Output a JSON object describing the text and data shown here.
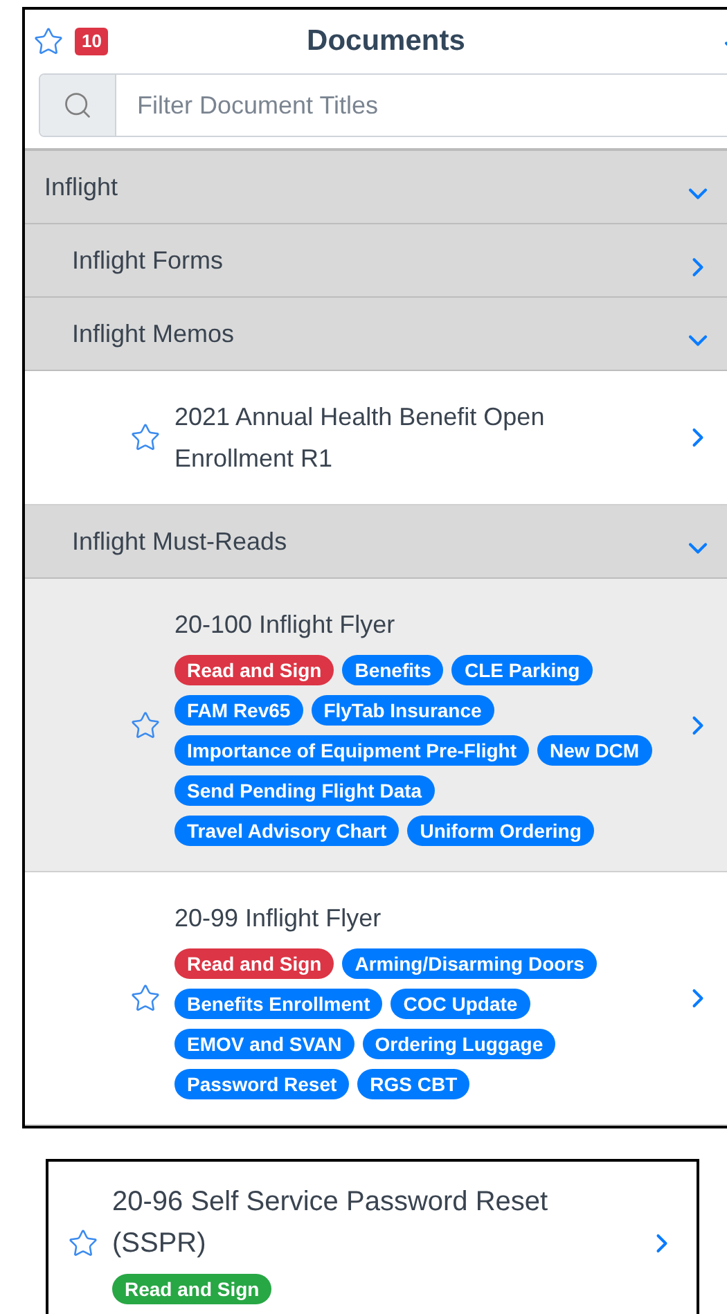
{
  "header": {
    "favorite": false,
    "badge": "10",
    "title": "Documents",
    "expanded": true
  },
  "search": {
    "placeholder": "Filter Document Titles"
  },
  "tree": [
    {
      "kind": "folder",
      "label": "Inflight",
      "expanded": true,
      "children": [
        {
          "kind": "folder",
          "label": "Inflight Forms",
          "expanded": false
        },
        {
          "kind": "folder",
          "label": "Inflight Memos",
          "expanded": true,
          "children": [
            {
              "kind": "document",
              "title": "2021 Annual Health Benefit Open Enrollment R1",
              "favorite": false,
              "selected": false
            }
          ]
        },
        {
          "kind": "folder",
          "label": "Inflight Must-Reads",
          "expanded": true,
          "children": [
            {
              "kind": "document",
              "title": "20-100 Inflight Flyer",
              "favorite": false,
              "selected": true,
              "tags": [
                {
                  "label": "Read and Sign",
                  "color": "#dc3545"
                },
                {
                  "label": "Benefits",
                  "color": "#007bff"
                },
                {
                  "label": "CLE Parking",
                  "color": "#007bff"
                },
                {
                  "label": "FAM Rev65",
                  "color": "#007bff"
                },
                {
                  "label": "FlyTab Insurance",
                  "color": "#007bff"
                },
                {
                  "label": "Importance of Equipment Pre-Flight",
                  "color": "#007bff"
                },
                {
                  "label": "New DCM",
                  "color": "#007bff"
                },
                {
                  "label": "Send Pending Flight Data",
                  "color": "#007bff"
                },
                {
                  "label": "Travel Advisory Chart",
                  "color": "#007bff"
                },
                {
                  "label": "Uniform Ordering",
                  "color": "#007bff"
                }
              ]
            },
            {
              "kind": "document",
              "title": "20-99 Inflight Flyer",
              "favorite": false,
              "selected": false,
              "tags": [
                {
                  "label": "Read and Sign",
                  "color": "#dc3545"
                },
                {
                  "label": "Arming/Disarming Doors",
                  "color": "#007bff"
                },
                {
                  "label": "Benefits Enrollment",
                  "color": "#007bff"
                },
                {
                  "label": "COC Update",
                  "color": "#007bff"
                },
                {
                  "label": "EMOV and SVAN",
                  "color": "#007bff"
                },
                {
                  "label": "Ordering Luggage",
                  "color": "#007bff"
                },
                {
                  "label": "Password Reset",
                  "color": "#007bff"
                },
                {
                  "label": "RGS CBT",
                  "color": "#007bff"
                }
              ]
            }
          ]
        }
      ]
    }
  ],
  "detached_document": {
    "kind": "document",
    "title": "20-96 Self Service Password Reset (SSPR)",
    "favorite": false,
    "selected": false,
    "tags": [
      {
        "label": "Read and Sign",
        "color": "#28a745"
      }
    ]
  }
}
